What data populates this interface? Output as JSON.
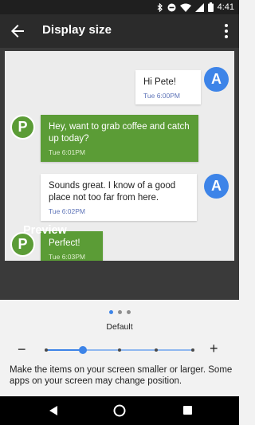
{
  "status_bar": {
    "time": "4:41",
    "icons": [
      "bluetooth-icon",
      "do-not-disturb-icon",
      "wifi-icon",
      "signal-icon",
      "battery-icon"
    ]
  },
  "app_bar": {
    "title": "Display size",
    "back_icon": "arrow-back-icon",
    "menu_icon": "more-vert-icon"
  },
  "messages": [
    {
      "sender": "A",
      "text": "Hi Pete!",
      "time": "Tue 6:00PM",
      "side": "right"
    },
    {
      "sender": "P",
      "text": "Hey, want to grab coffee and catch up today?",
      "time": "Tue 6:01PM",
      "side": "left"
    },
    {
      "sender": "A",
      "text": "Sounds great. I know of a good place not too far from here.",
      "time": "Tue 6:02PM",
      "side": "right"
    },
    {
      "sender": "P",
      "text": "Perfect!",
      "time": "Tue 6:03PM",
      "side": "left"
    }
  ],
  "preview_label": "Preview",
  "size": {
    "current_label": "Default",
    "minus_label": "−",
    "plus_label": "+",
    "steps": 5,
    "current_index": 1,
    "page_count": 3,
    "page_index": 0
  },
  "description": "Make the items on your screen smaller or larger. Some apps on your screen may change position.",
  "colors": {
    "accent": "#3d84e8",
    "green": "#5b9c36",
    "app_bar": "#2b2b2b"
  }
}
